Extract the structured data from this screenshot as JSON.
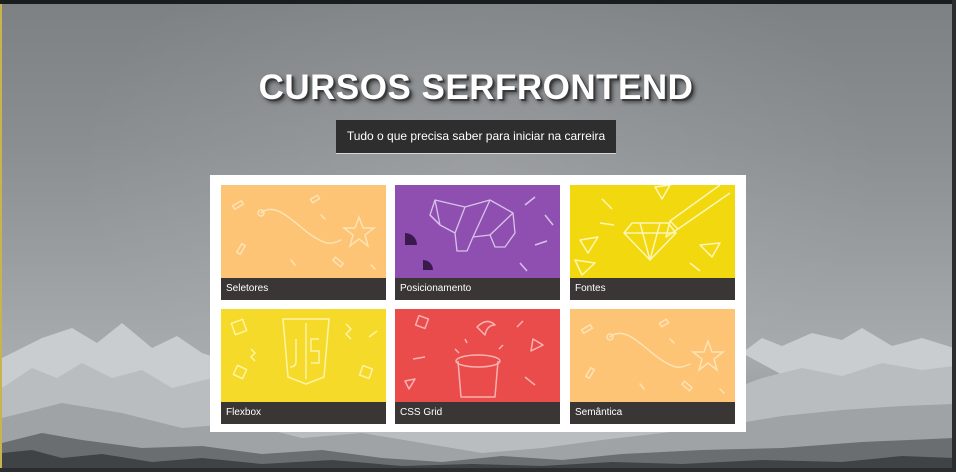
{
  "header": {
    "title": "CURSOS SERFRONTEND",
    "subtitle": "Tudo o que precisa saber para iniciar na carreira"
  },
  "courses": [
    {
      "label": "Seletores",
      "color": "#fcc474",
      "icon": "star-path-icon"
    },
    {
      "label": "Posicionamento",
      "color": "#8e4fb1",
      "icon": "origami-elephant-icon"
    },
    {
      "label": "Fontes",
      "color": "#f1d80f",
      "icon": "diamond-pencil-icon"
    },
    {
      "label": "Flexbox",
      "color": "#f5da2a",
      "icon": "js-badge-icon"
    },
    {
      "label": "CSS Grid",
      "color": "#ea4c4c",
      "icon": "magic-hat-icon"
    },
    {
      "label": "Semântica",
      "color": "#fcc474",
      "icon": "star-path-icon"
    }
  ]
}
